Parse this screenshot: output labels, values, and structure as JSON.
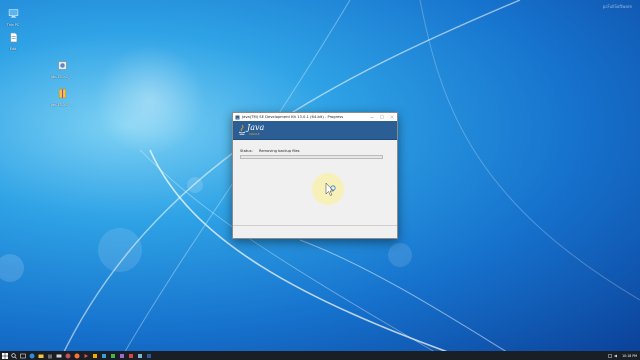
{
  "watermark": "pcFullSoftware",
  "desktop_icons": [
    {
      "label": "This PC",
      "icon": "computer-icon"
    },
    {
      "label": "Edit",
      "icon": "file-icon"
    },
    {
      "label": "jdk-13.0.1_...",
      "icon": "installer-icon"
    },
    {
      "label": "jdk-13.0.1_...",
      "icon": "archive-icon"
    }
  ],
  "dialog": {
    "title": "Java(TM) SE Development Kit 13.0.1 (64-bit) - Progress",
    "logo_text": "Java",
    "logo_sub": "ORACLE",
    "status_label": "Status:",
    "status_value": "Removing backup files",
    "progress_fraction": 0,
    "controls": [
      "minimize",
      "maximize",
      "close"
    ]
  },
  "taskbar": {
    "items": [
      "start-icon",
      "search-icon",
      "task-view-icon",
      "edge-icon",
      "file-explorer-icon",
      "store-icon",
      "mail-icon",
      "chrome-icon",
      "firefox-icon",
      "media-icon",
      "app-icon",
      "app-icon",
      "app-icon",
      "app-icon",
      "app-icon",
      "app-icon",
      "java-icon"
    ],
    "clock": "10:18 PM"
  },
  "colors": {
    "banner": "#2b5e94",
    "taskbar": "#1a1f26",
    "progress_fill": "#06b025"
  }
}
